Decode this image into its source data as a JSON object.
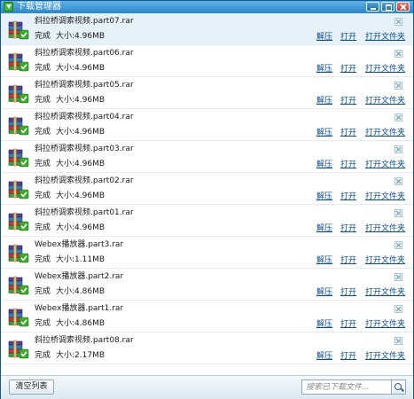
{
  "window": {
    "title": "下载管理器",
    "icon": "download-arrow-icon"
  },
  "actions": {
    "unzip": "解压",
    "open": "打开",
    "open_folder": "打开文件夹"
  },
  "items": [
    {
      "name": "斜拉桥调索视频.part07.rar",
      "status": "完成",
      "size": "大小:4.96MB",
      "selected": true
    },
    {
      "name": "斜拉桥调索视频.part06.rar",
      "status": "完成",
      "size": "大小:4.96MB",
      "selected": false
    },
    {
      "name": "斜拉桥调索视频.part05.rar",
      "status": "完成",
      "size": "大小:4.96MB",
      "selected": false
    },
    {
      "name": "斜拉桥调索视频.part04.rar",
      "status": "完成",
      "size": "大小:4.96MB",
      "selected": false
    },
    {
      "name": "斜拉桥调索视频.part03.rar",
      "status": "完成",
      "size": "大小:4.96MB",
      "selected": false
    },
    {
      "name": "斜拉桥调索视频.part02.rar",
      "status": "完成",
      "size": "大小:4.96MB",
      "selected": false
    },
    {
      "name": "斜拉桥调索视频.part01.rar",
      "status": "完成",
      "size": "大小:4.96MB",
      "selected": false
    },
    {
      "name": "Webex播放器.part3.rar",
      "status": "完成",
      "size": "大小:1.11MB",
      "selected": false
    },
    {
      "name": "Webex播放器.part2.rar",
      "status": "完成",
      "size": "大小:4.86MB",
      "selected": false
    },
    {
      "name": "Webex播放器.part1.rar",
      "status": "完成",
      "size": "大小:4.86MB",
      "selected": false
    },
    {
      "name": "斜拉桥调索视频.part08.rar",
      "status": "完成",
      "size": "大小:2.17MB",
      "selected": false
    }
  ],
  "footer": {
    "clear_label": "清空列表",
    "search_placeholder": "搜索已下载文件..."
  },
  "colors": {
    "titlebar": "#2a86c8",
    "selected_row": "#e6f1fa",
    "link": "#0b4c8c",
    "check_green": "#3daa2e"
  }
}
